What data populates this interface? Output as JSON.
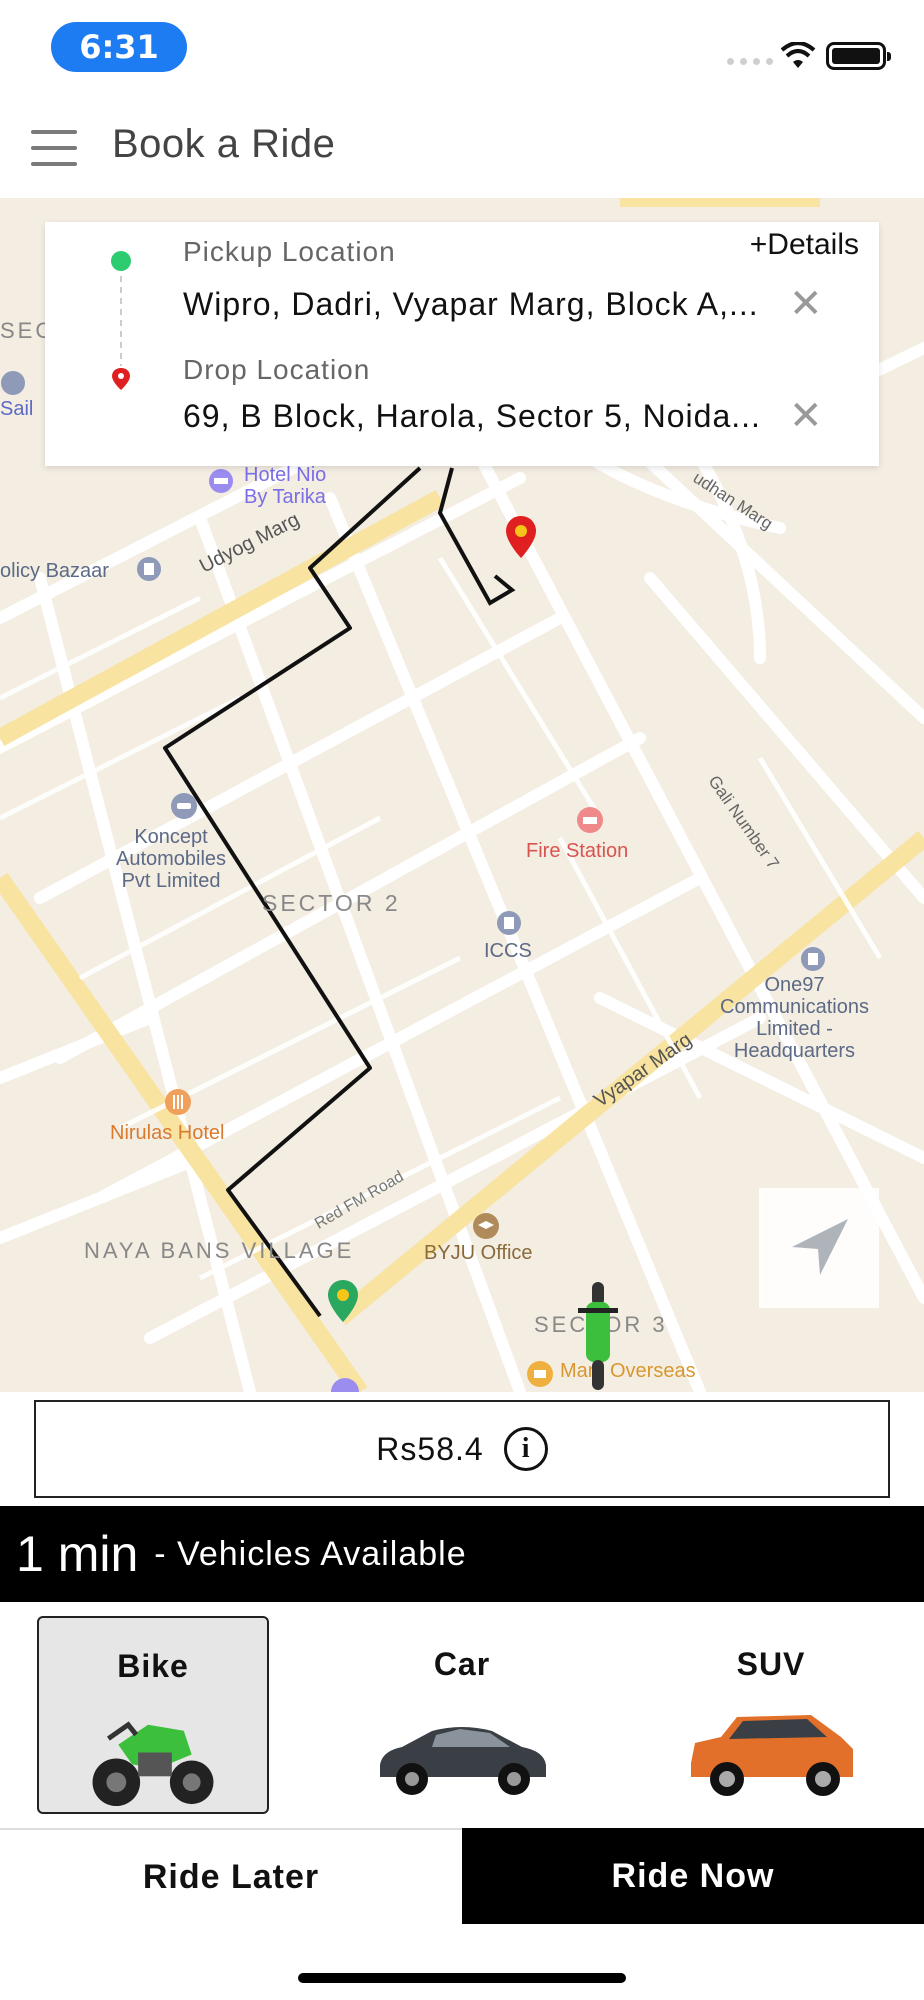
{
  "status_bar": {
    "time": "6:31"
  },
  "header": {
    "title": "Book a Ride"
  },
  "locations": {
    "details_label": "+Details",
    "pickup": {
      "label": "Pickup Location",
      "value": "Wipro, Dadri, Vyapar Marg, Block A,..."
    },
    "drop": {
      "label": "Drop Location",
      "value": "69, B Block, Harola, Sector 5, Noida..."
    },
    "clear_symbol": "✕"
  },
  "map": {
    "labels": {
      "hotel_nio": "Hotel Nio\nBy Tarika",
      "policy_bazaar": "olicy Bazaar",
      "udyog_marg": "Udyog Marg",
      "sec_partial": "SEC",
      "sail": "Sail",
      "sudhan_marg": "udhan Marg",
      "fire_station": "Fire Station",
      "koncept": "Koncept\nAutomobiles\nPvt Limited",
      "sector2": "SECTOR 2",
      "iccs": "ICCS",
      "gali7": "Gali Number 7",
      "one97": "One97\nCommunications\nLimited -\nHeadquarters",
      "vyapar_marg": "Vyapar Marg",
      "nirulas": "Nirulas Hotel",
      "red_fm": "Red FM Road",
      "byju": "BYJU Office",
      "naya_bans": "NAYA BANS VILLAGE",
      "sector3": "SECTOR 3",
      "mars": "Mars Overseas"
    }
  },
  "fare": {
    "amount": "Rs58.4",
    "info_symbol": "i"
  },
  "availability": {
    "eta": "1 min",
    "text": "- Vehicles Available"
  },
  "vehicles": [
    {
      "name": "Bike",
      "selected": true
    },
    {
      "name": "Car",
      "selected": false
    },
    {
      "name": "SUV",
      "selected": false
    }
  ],
  "actions": {
    "ride_later": "Ride Later",
    "ride_now": "Ride Now"
  },
  "colors": {
    "pickup_green": "#2ecc71",
    "drop_red": "#e02020",
    "black": "#000000",
    "road_yellow": "#f8e3a0",
    "map_bg": "#f3ede2"
  }
}
